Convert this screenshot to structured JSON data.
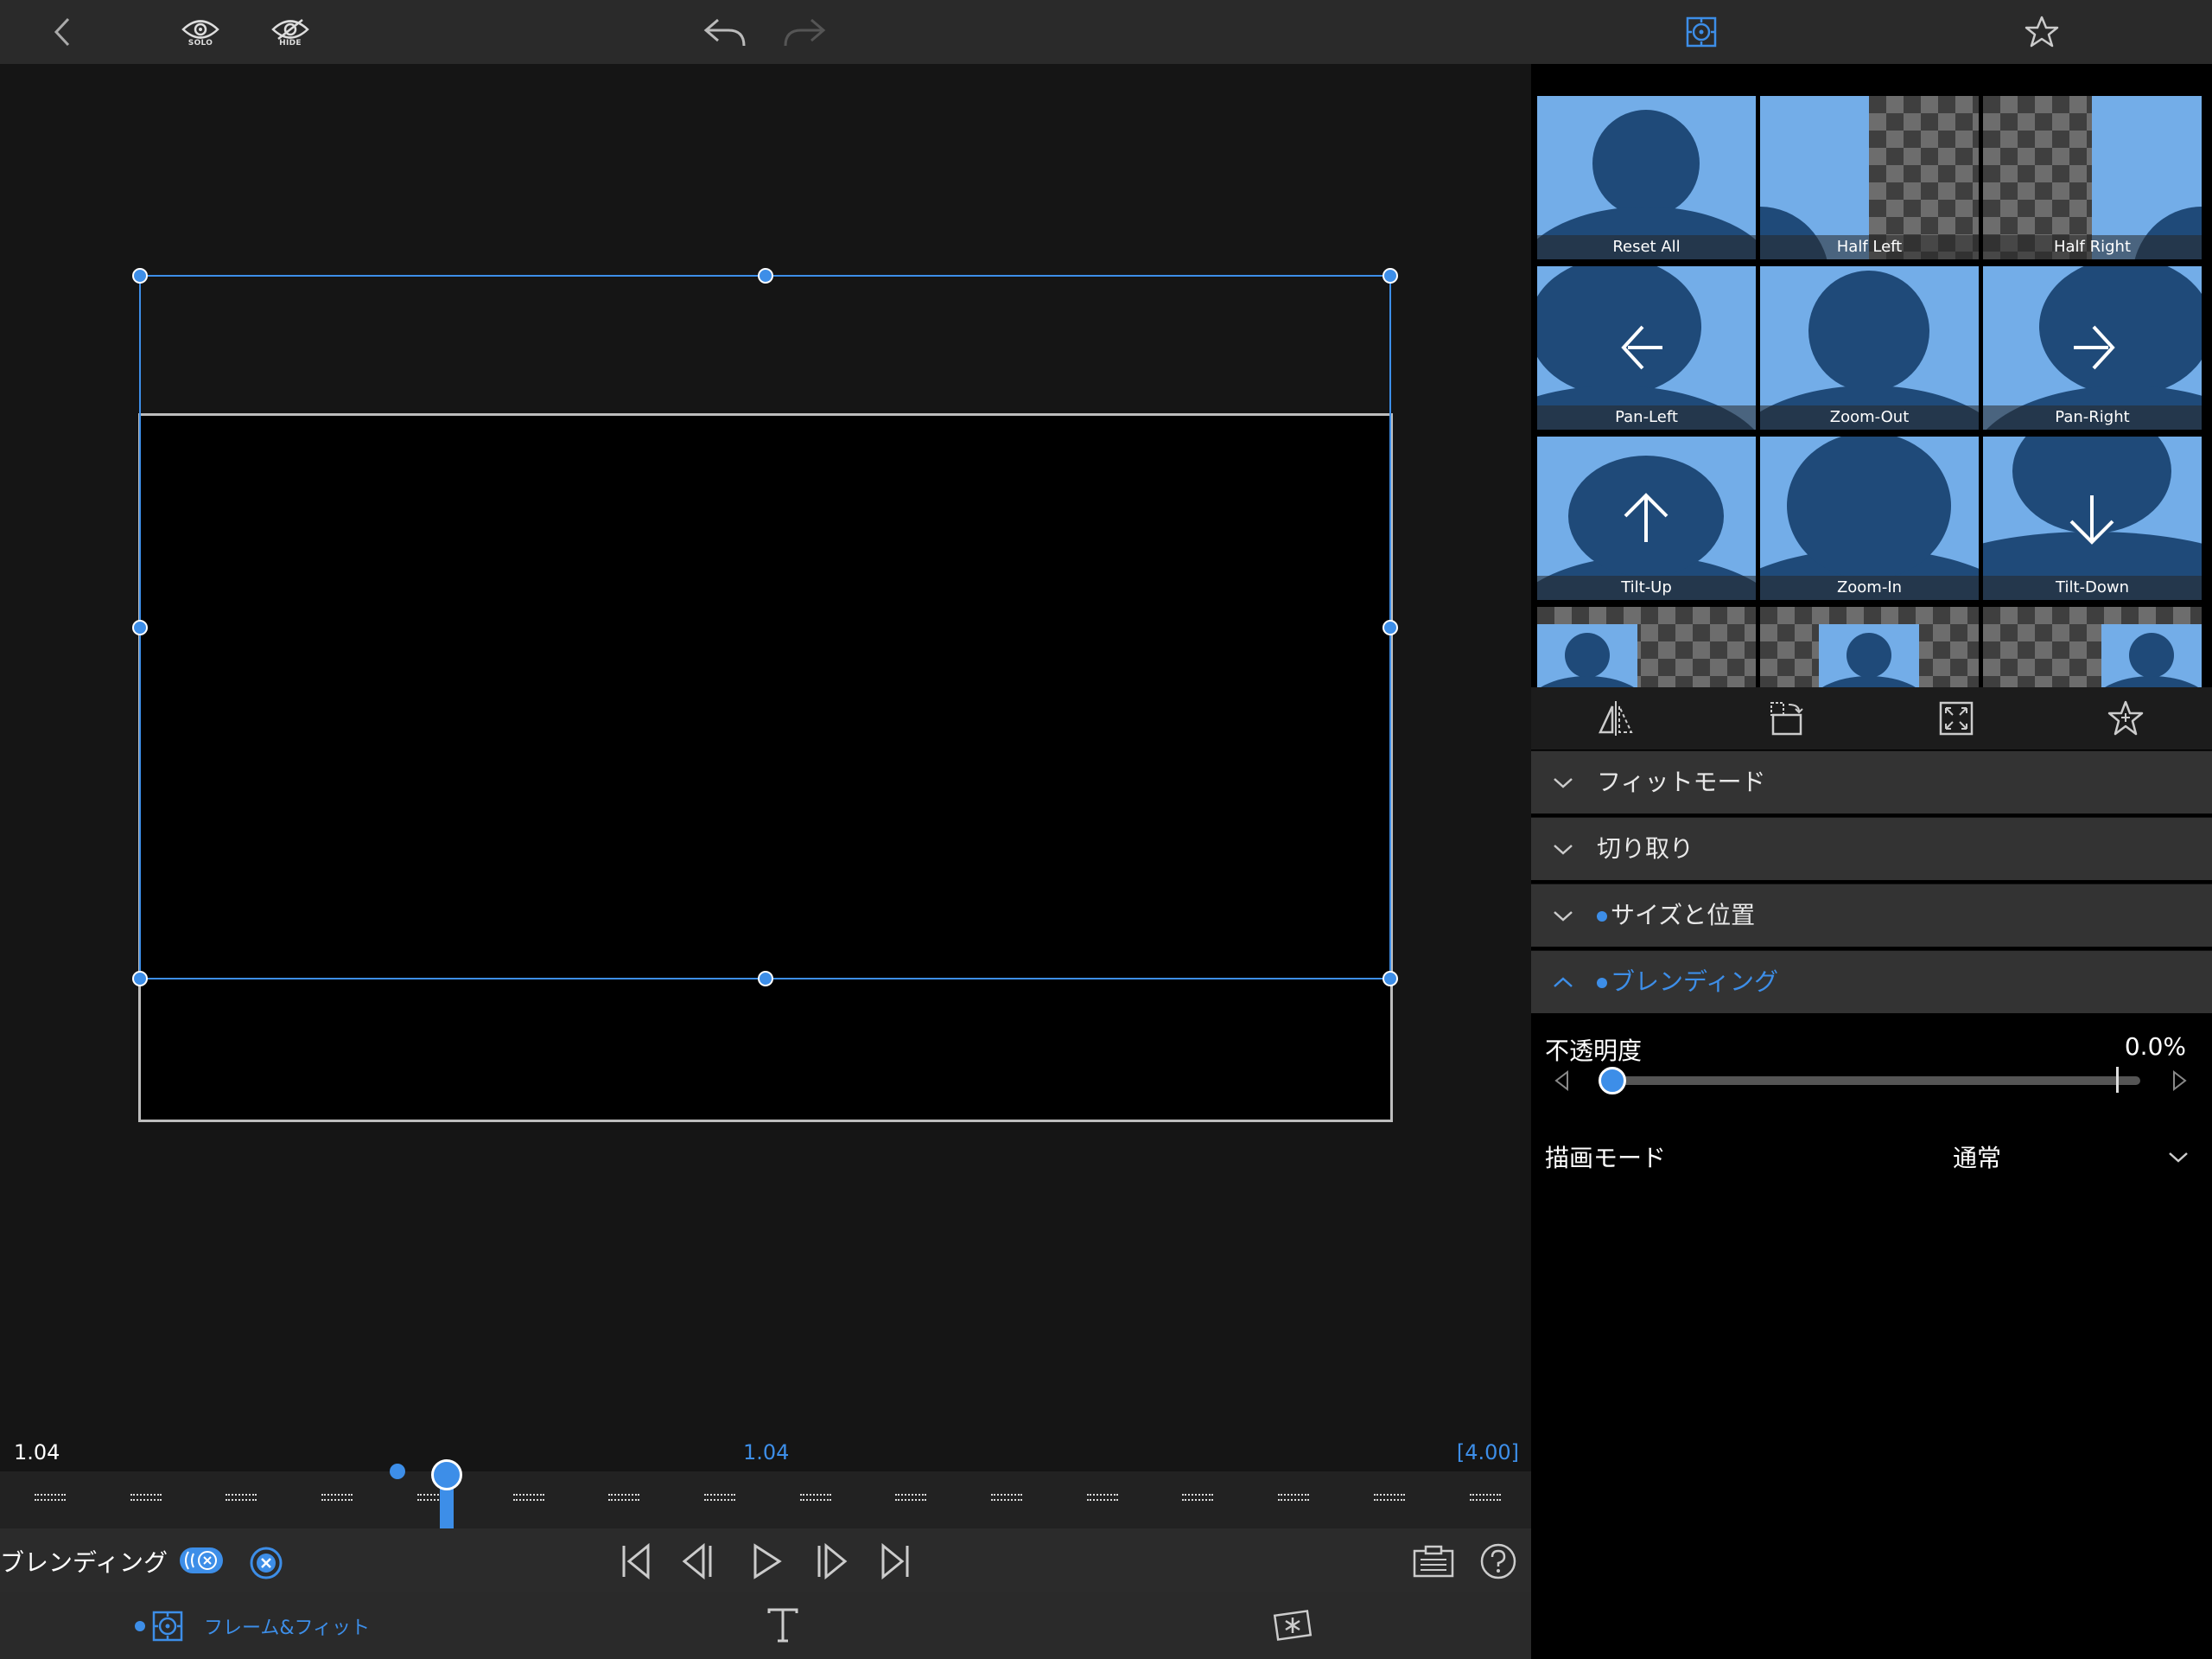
{
  "topbar": {
    "solo_label": "SOLO",
    "hide_label": "HIDE"
  },
  "presets": [
    {
      "label": "Reset All"
    },
    {
      "label": "Half Left"
    },
    {
      "label": "Half Right"
    },
    {
      "label": "Pan-Left"
    },
    {
      "label": "Zoom-Out"
    },
    {
      "label": "Pan-Right"
    },
    {
      "label": "Tilt-Up"
    },
    {
      "label": "Zoom-In"
    },
    {
      "label": "Tilt-Down"
    }
  ],
  "sections": {
    "fit_mode": "フィットモード",
    "crop": "切り取り",
    "size_position": "サイズと位置",
    "blending": "ブレンディング"
  },
  "blending": {
    "opacity_label": "不透明度",
    "opacity_value": "0.0%",
    "opacity_fraction": 0.0,
    "draw_mode_label": "描画モード",
    "draw_mode_value": "通常"
  },
  "timeline": {
    "current_time": "1.04",
    "playhead_time": "1.04",
    "duration": "[4.00]",
    "tick_count": 16
  },
  "controls": {
    "track_label": "ブレンディング"
  },
  "bottom_tabs": {
    "frame_fit_label": "フレーム&フィット"
  },
  "colors": {
    "accent": "#3d8ee8",
    "tile_bg": "#73ade8",
    "silhouette": "#1f4a79"
  },
  "icons": [
    "back-icon",
    "eye-solo-icon",
    "eye-hide-icon",
    "undo-icon",
    "redo-icon",
    "frame-target-icon",
    "star-icon",
    "flip-icon",
    "rotate-icon",
    "fit-fill-icon",
    "favorite-icon",
    "chevron-down-icon",
    "chevron-up-icon",
    "skip-start-icon",
    "step-back-icon",
    "play-icon",
    "step-forward-icon",
    "skip-end-icon",
    "clipboard-icon",
    "help-icon",
    "text-icon",
    "effects-icon"
  ]
}
